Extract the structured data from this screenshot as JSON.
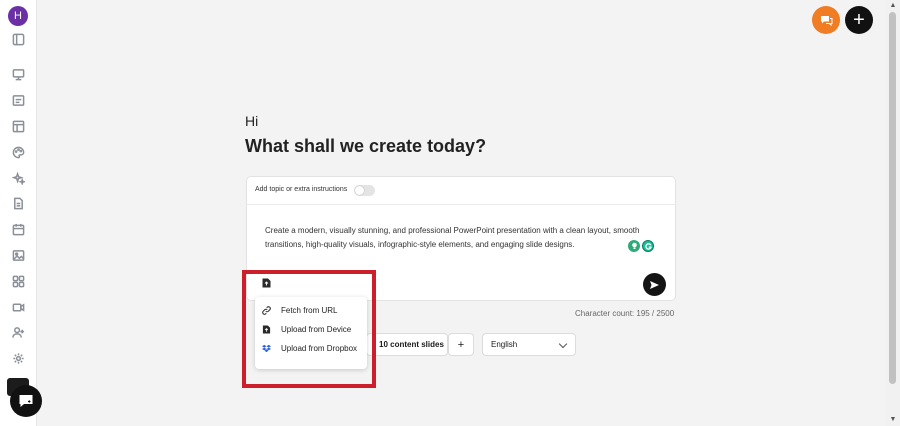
{
  "user": {
    "avatar_initial": "H"
  },
  "sidebar": {
    "icons": [
      "panel-toggle-icon",
      "presentation-icon",
      "slides-icon",
      "layout-icon",
      "palette-icon",
      "sparkle-icon",
      "document-icon",
      "calendar-icon",
      "image-icon",
      "apps-icon",
      "video-icon",
      "add-user-icon",
      "settings-icon"
    ]
  },
  "header": {
    "plus_label": "+"
  },
  "main": {
    "greeting": "Hi",
    "headline": "What shall we create today?"
  },
  "prompt_card": {
    "toggle_label": "Add topic or extra instructions",
    "prompt_text": "Create a modern, visually stunning, and professional PowerPoint presentation with a clean layout, smooth transitions, high-quality visuals, infographic-style elements, and engaging slide designs.",
    "char_count": "Character count: 195 / 2500"
  },
  "upload_menu": {
    "items": [
      {
        "label": "Fetch from URL",
        "icon": "link-icon"
      },
      {
        "label": "Upload from Device",
        "icon": "file-upload-icon"
      },
      {
        "label": "Upload from Dropbox",
        "icon": "dropbox-icon"
      }
    ]
  },
  "controls": {
    "slides_label": "10 content slides",
    "add_label": "+",
    "language": "English"
  },
  "colors": {
    "accent_orange": "#f07c23",
    "avatar_purple": "#6b2fa6",
    "highlight_red": "#cc1f2b"
  }
}
